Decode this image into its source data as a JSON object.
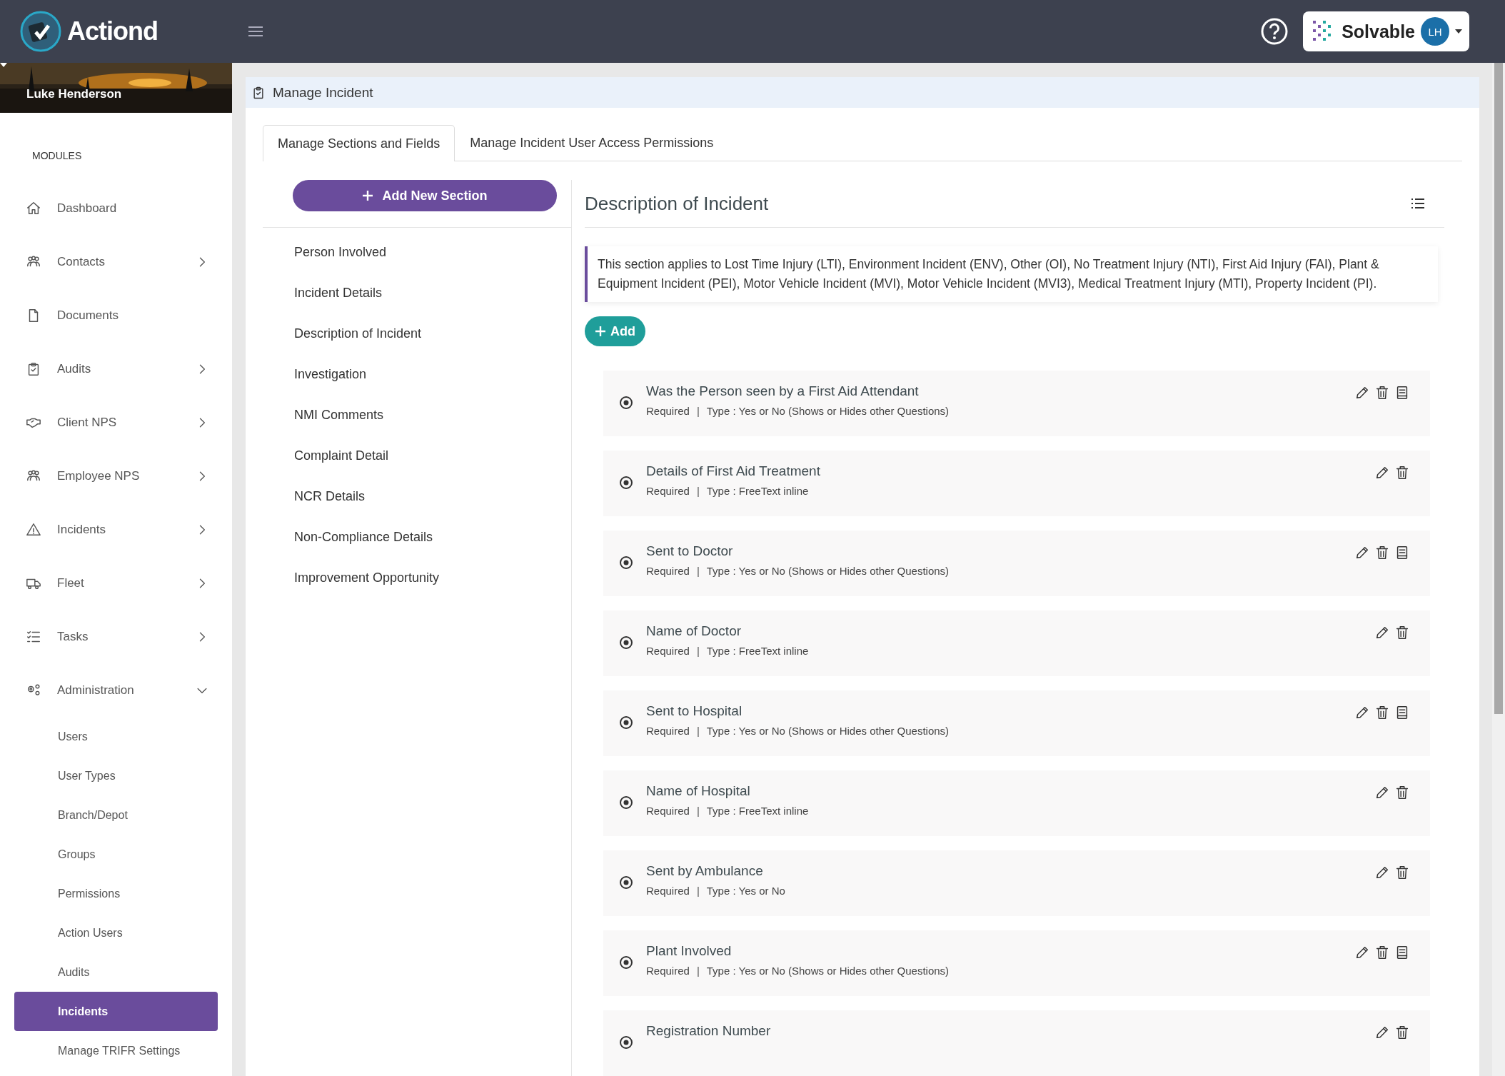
{
  "header": {
    "logo": "Actiond",
    "company": "Solvable",
    "avatar": "LH"
  },
  "user": {
    "name": "Luke Henderson"
  },
  "sidebar": {
    "heading": "MODULES",
    "items": [
      {
        "label": "Dashboard",
        "has_children": false
      },
      {
        "label": "Contacts",
        "has_children": true,
        "expanded": false
      },
      {
        "label": "Documents",
        "has_children": false
      },
      {
        "label": "Audits",
        "has_children": true,
        "expanded": false
      },
      {
        "label": "Client NPS",
        "has_children": true,
        "expanded": false
      },
      {
        "label": "Employee NPS",
        "has_children": true,
        "expanded": false
      },
      {
        "label": "Incidents",
        "has_children": true,
        "expanded": false
      },
      {
        "label": "Fleet",
        "has_children": true,
        "expanded": false
      },
      {
        "label": "Tasks",
        "has_children": true,
        "expanded": false
      },
      {
        "label": "Administration",
        "has_children": true,
        "expanded": true,
        "children": [
          {
            "label": "Users",
            "selected": false
          },
          {
            "label": "User Types",
            "selected": false
          },
          {
            "label": "Branch/Depot",
            "selected": false
          },
          {
            "label": "Groups",
            "selected": false
          },
          {
            "label": "Permissions",
            "selected": false
          },
          {
            "label": "Action Users",
            "selected": false
          },
          {
            "label": "Audits",
            "selected": false
          },
          {
            "label": "Incidents",
            "selected": true
          },
          {
            "label": "Manage TRIFR Settings",
            "selected": false
          }
        ]
      }
    ]
  },
  "page": {
    "title": "Manage Incident"
  },
  "tabs": [
    {
      "label": "Manage Sections and Fields",
      "selected": true
    },
    {
      "label": "Manage Incident User Access Permissions",
      "selected": false
    }
  ],
  "add_section_button": "Add New Section",
  "sections": [
    {
      "label": "Person Involved"
    },
    {
      "label": "Incident Details"
    },
    {
      "label": "Description of Incident"
    },
    {
      "label": "Investigation"
    },
    {
      "label": "NMI Comments"
    },
    {
      "label": "Complaint Detail"
    },
    {
      "label": "NCR Details"
    },
    {
      "label": "Non-Compliance Details"
    },
    {
      "label": "Improvement Opportunity"
    }
  ],
  "section_detail": {
    "title": "Description of Incident",
    "note": "This section applies to Lost Time Injury (LTI), Environment Incident (ENV), Other (OI), No Treatment Injury (NTI), First Aid Injury (FAI), Plant & Equipment Incident (PEI), Motor Vehicle Incident (MVI), Motor Vehicle Incident (MVI3), Medical Treatment Injury (MTI), Property Incident (PI).",
    "add_button": "Add"
  },
  "fields": [
    {
      "title": "Was the Person seen by a First Aid Attendant",
      "required": "Required",
      "separator": "|",
      "type": "Type : Yes or No (Shows or Hides other Questions)",
      "has_notes": true
    },
    {
      "title": "Details of First Aid Treatment",
      "required": "Required",
      "separator": "|",
      "type": "Type : FreeText inline",
      "has_notes": false
    },
    {
      "title": "Sent to Doctor",
      "required": "Required",
      "separator": "|",
      "type": "Type : Yes or No (Shows or Hides other Questions)",
      "has_notes": true
    },
    {
      "title": "Name of Doctor",
      "required": "Required",
      "separator": "|",
      "type": "Type : FreeText inline",
      "has_notes": false
    },
    {
      "title": "Sent to Hospital",
      "required": "Required",
      "separator": "|",
      "type": "Type : Yes or No (Shows or Hides other Questions)",
      "has_notes": true
    },
    {
      "title": "Name of Hospital",
      "required": "Required",
      "separator": "|",
      "type": "Type : FreeText inline",
      "has_notes": false
    },
    {
      "title": "Sent by Ambulance",
      "required": "Required",
      "separator": "|",
      "type": "Type : Yes or No",
      "has_notes": false
    },
    {
      "title": "Plant Involved",
      "required": "Required",
      "separator": "|",
      "type": "Type : Yes or No (Shows or Hides other Questions)",
      "has_notes": true
    },
    {
      "title": "Registration Number",
      "has_notes": false
    }
  ]
}
